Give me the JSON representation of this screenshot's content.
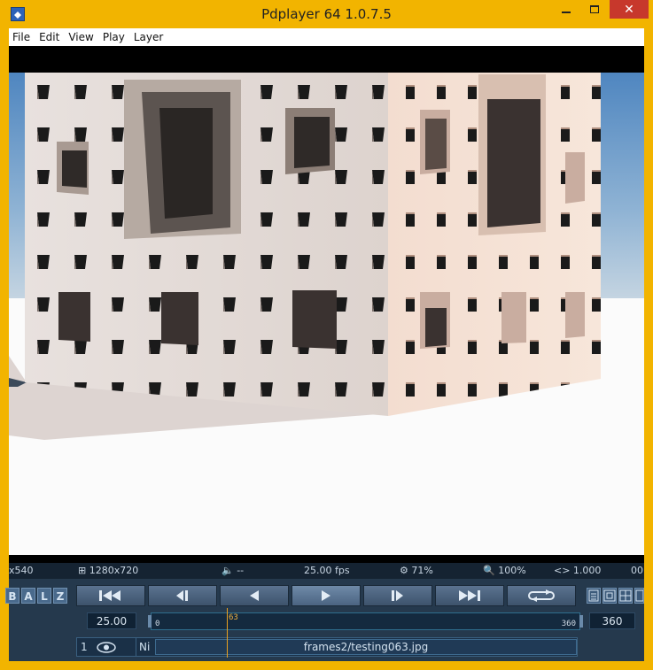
{
  "window": {
    "title": "Pdplayer 64 1.0.7.5",
    "close_glyph": "✕"
  },
  "menu": {
    "items": [
      "File",
      "Edit",
      "View",
      "Play",
      "Layer"
    ]
  },
  "status": {
    "source_res": "x540",
    "output_res": "⊞ 1280x720",
    "audio": "🔈 --",
    "fps": "25.00 fps",
    "zoom_fit": "⚙ 71%",
    "zoom": "🔍 100%",
    "aspect": "<> 1.000",
    "extra": "00"
  },
  "layer_buttons": [
    "B",
    "A",
    "L",
    "Z"
  ],
  "transport": {
    "buttons": [
      "go-to-start",
      "step-back",
      "play-backward",
      "play-forward",
      "step-forward",
      "go-to-end",
      "loop"
    ]
  },
  "timeline": {
    "fps_value": "25.00",
    "start_frame": "0",
    "end_frame": "360",
    "current_frame": "63",
    "end_value": "360",
    "progress": 0.175
  },
  "layer": {
    "number": "1",
    "mode": "Ni",
    "filename": "frames2/testing063.jpg"
  },
  "colors": {
    "titlebar": "#f2b400",
    "close_button": "#c7382c",
    "panel": "#25394d",
    "status": "#152332",
    "playhead": "#e8a020"
  }
}
